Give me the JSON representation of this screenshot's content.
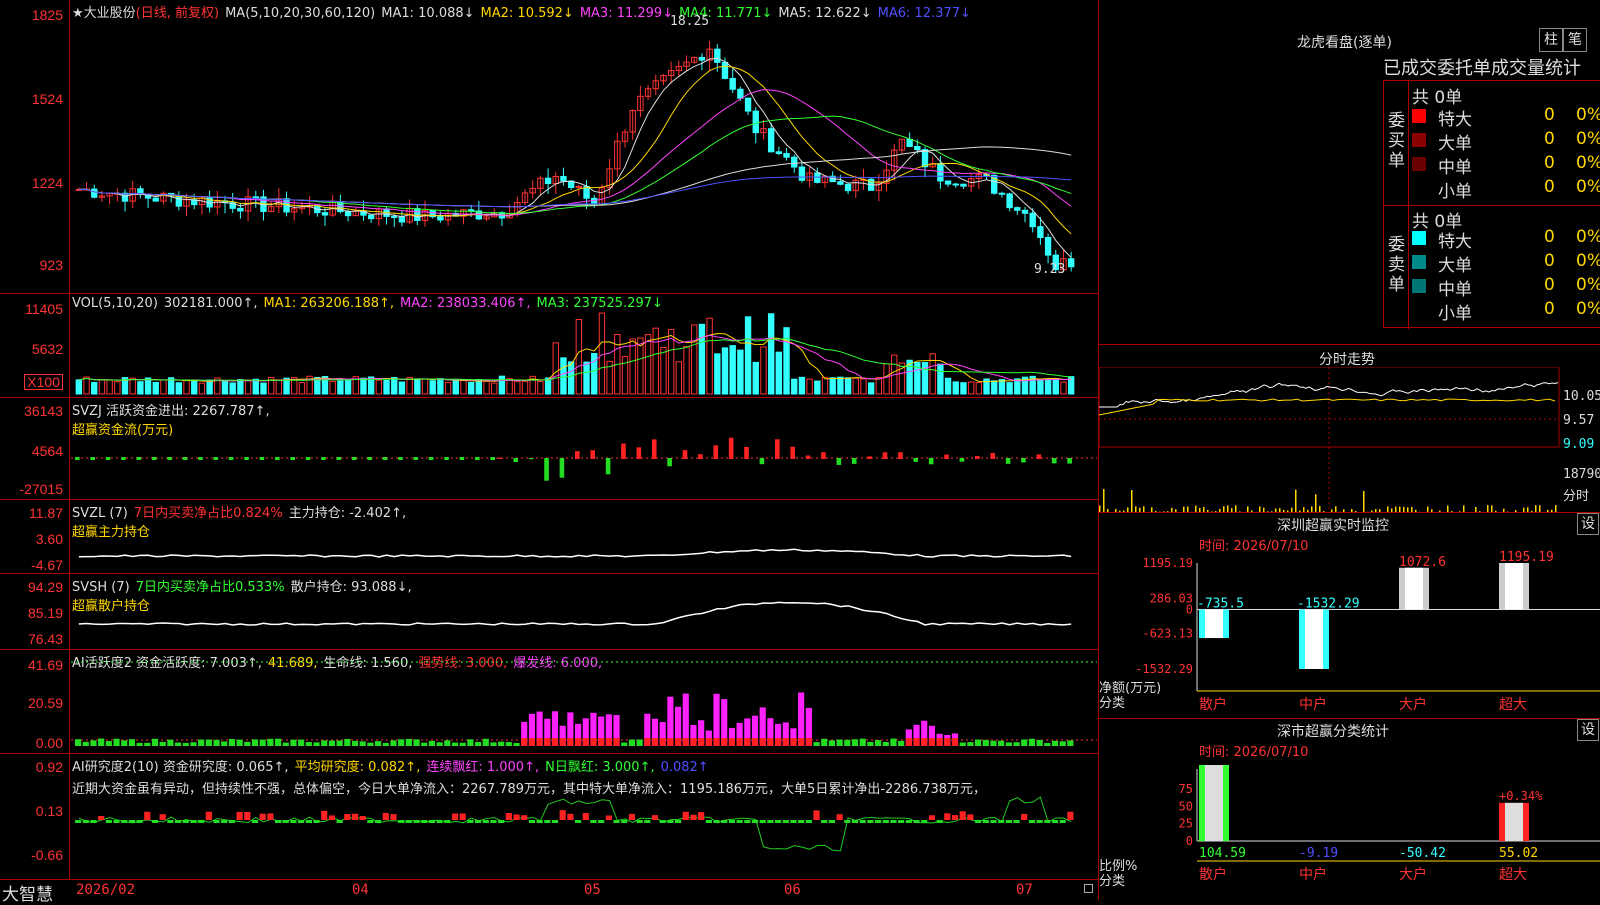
{
  "main": {
    "stock_name": "★大业股份",
    "period": "(日线, 前复权)",
    "ma_items": [
      {
        "label": "MA(5,10,20,30,60,120)",
        "color": "#dddddd"
      },
      {
        "label": "MA1: 10.088↓",
        "color": "#dddddd"
      },
      {
        "label": "MA2: 10.592↓",
        "color": "#ffd700"
      },
      {
        "label": "MA3: 11.299↓",
        "color": "#ff44ff"
      },
      {
        "label": "MA4: 11.771↓",
        "color": "#33ff33"
      },
      {
        "label": "MA5: 12.622↓",
        "color": "#dddddd"
      },
      {
        "label": "MA6: 12.377↓",
        "color": "#5050ff"
      }
    ],
    "ticks": [
      "1825",
      "1524",
      "1224",
      "923"
    ],
    "high_label": "18.25",
    "low_label": "9.23"
  },
  "vol": {
    "header": [
      {
        "label": "VOL(5,10,20)",
        "color": "#dddddd"
      },
      {
        "label": "302181.000↑,",
        "color": "#dddddd"
      },
      {
        "label": "MA1: 263206.188↑,",
        "color": "#ffd700"
      },
      {
        "label": "MA2: 238033.406↑,",
        "color": "#ff44ff"
      },
      {
        "label": "MA3: 237525.297↓",
        "color": "#33ff33"
      }
    ],
    "ticks": [
      "11405",
      "5632"
    ],
    "unit": "X100"
  },
  "svzj": {
    "line1": "SVZJ  活跃资金进出: 2267.787↑,",
    "line2": "超赢资金流(万元)",
    "ticks": [
      "36143",
      "4564",
      "-27015"
    ]
  },
  "svzl": {
    "line1a": "SVZL (7)",
    "line1b": "7日内买卖净占比0.824%",
    "line1c": "主力持仓: -2.402↑,",
    "line2": "超赢主力持仓",
    "ticks": [
      "11.87",
      "3.60",
      "-4.67"
    ]
  },
  "svsh": {
    "line1a": "SVSH (7)",
    "line1b": "7日内买卖净占比0.533%",
    "line1c": "散户持仓: 93.088↓,",
    "line2": "超赢散户持仓",
    "ticks": [
      "94.29",
      "85.19",
      "76.43"
    ]
  },
  "ai_active": {
    "header": [
      {
        "label": "AI活跃度2 资金活跃度: 7.003↑,",
        "color": "#dddddd"
      },
      {
        "label": "41.689,",
        "color": "#ffd700"
      },
      {
        "label": "生命线: 1.560,",
        "color": "#dddddd"
      },
      {
        "label": "强势线: 3.000,",
        "color": "#ff3333"
      },
      {
        "label": "爆发线: 6.000,",
        "color": "#ff44ff"
      }
    ],
    "ticks": [
      "41.69",
      "20.59",
      "0.00"
    ]
  },
  "ai_research": {
    "header": [
      {
        "label": "AI研究度2(10) 资金研究度: 0.065↑,",
        "color": "#dddddd"
      },
      {
        "label": "平均研究度: 0.082↑,",
        "color": "#ffd700"
      },
      {
        "label": "连续飘红: 1.000↑,",
        "color": "#ff44ff"
      },
      {
        "label": "N日飘红: 3.000↑,",
        "color": "#33ff33"
      },
      {
        "label": "0.082↑",
        "color": "#5050ff"
      }
    ],
    "comment": "近期大资金虽有异动，但持续性不强，总体偏空，今日大单净流入：2267.789万元，其中特大单净流入：1195.186万元，大单5日累计净出-2286.738万元，",
    "ticks": [
      "0.92",
      "0.13",
      "-0.66"
    ]
  },
  "bottom_axis": {
    "brand": "大智慧",
    "labels": [
      "2026/02",
      "04",
      "05",
      "06",
      "07"
    ]
  },
  "dragon": {
    "title": "龙虎看盘(逐单)",
    "btn1": "柱",
    "btn2": "笔",
    "tabs": "已成交委托单成交量统计",
    "buy_label": "委买单",
    "sell_label": "委卖单",
    "buy_total": "共 0单",
    "sell_total": "共 0单",
    "buy_rows": [
      {
        "name": "特大",
        "count": "0",
        "pct": "0%",
        "color": "#ff0000"
      },
      {
        "name": "大单",
        "count": "0",
        "pct": "0%",
        "color": "#8b0000"
      },
      {
        "name": "中单",
        "count": "0",
        "pct": "0%",
        "color": "#6b0000"
      },
      {
        "name": "小单",
        "count": "0",
        "pct": "0%",
        "color": "#000000"
      }
    ],
    "sell_rows": [
      {
        "name": "特大",
        "count": "0",
        "pct": "0%",
        "color": "#00ffff"
      },
      {
        "name": "大单",
        "count": "0",
        "pct": "0%",
        "color": "#008b8b"
      },
      {
        "name": "中单",
        "count": "0",
        "pct": "0%",
        "color": "#007777"
      },
      {
        "name": "小单",
        "count": "0",
        "pct": "0%",
        "color": "#000000"
      }
    ]
  },
  "intraday": {
    "title": "分时走势",
    "ticks": [
      "10.05",
      "9.57",
      "9.09",
      "18790",
      "分时"
    ]
  },
  "sz_monitor": {
    "title": "深圳超赢实时监控",
    "set": "设",
    "time": "时间: 2026/07/10",
    "ticks": [
      "1195.19",
      "286.03",
      "0",
      "-623.13",
      "-1532.29"
    ],
    "ylabel": "净额(万元)",
    "xlabel": "分类",
    "bars": [
      {
        "name": "散户",
        "value": -735.5,
        "label": "-735.5"
      },
      {
        "name": "中户",
        "value": -1532.29,
        "label": "-1532.29"
      },
      {
        "name": "大户",
        "value": 1072.6,
        "label": "1072.6"
      },
      {
        "name": "超大",
        "value": 1195.19,
        "label": "1195.19"
      }
    ]
  },
  "sz_class": {
    "title": "深市超赢分类统计",
    "set": "设",
    "time": "时间: 2026/07/10",
    "ticks": [
      "75",
      "50",
      "25",
      "0"
    ],
    "ylabel": "比例%",
    "xlabel": "分类",
    "bars": [
      {
        "name": "散户",
        "value": 104.59,
        "label": "104.59"
      },
      {
        "name": "中户",
        "value": -9.19,
        "label": "-9.19"
      },
      {
        "name": "大户",
        "value": -50.42,
        "label": "-50.42"
      },
      {
        "name": "超大",
        "value": 55.02,
        "label": "55.02",
        "top": "+0.34%"
      }
    ]
  },
  "chart_data": [
    {
      "type": "bar",
      "title": "深圳超赢实时监控",
      "categories": [
        "散户",
        "中户",
        "大户",
        "超大"
      ],
      "values": [
        -735.5,
        -1532.29,
        1072.6,
        1195.19
      ],
      "ylabel": "净额(万元)",
      "xlabel": "分类",
      "ylim": [
        -1532.29,
        1195.19
      ]
    },
    {
      "type": "bar",
      "title": "深市超赢分类统计",
      "categories": [
        "散户",
        "中户",
        "大户",
        "超大"
      ],
      "values": [
        104.59,
        -9.19,
        -50.42,
        55.02
      ],
      "ylabel": "比例%",
      "xlabel": "分类",
      "ylim": [
        0,
        75
      ]
    }
  ]
}
